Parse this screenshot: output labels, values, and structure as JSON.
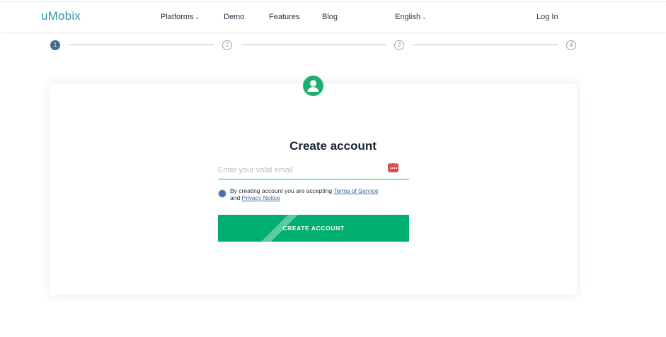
{
  "header": {
    "logo": "uMobix",
    "nav": {
      "platforms": "Platforms",
      "demo": "Demo",
      "features": "Features",
      "blog": "Blog",
      "language": "English",
      "login": "Log In"
    }
  },
  "stepper": {
    "steps": [
      "1",
      "2",
      "3",
      "4"
    ],
    "current": 1
  },
  "form": {
    "title": "Create account",
    "email_placeholder": "Enter your valid email",
    "email_value": "",
    "terms_prefix": "By creating account you are accepting ",
    "terms_link": "Terms of Service",
    "terms_and": " and ",
    "privacy_link": "Privacy Notice",
    "submit_label": "CREATE ACCOUNT"
  },
  "colors": {
    "brand_teal": "#2a9aa8",
    "accent_green": "#00ae70",
    "step_active": "#3f6b94",
    "link": "#3d6a9a",
    "password_manager_icon": "#e04a4a"
  },
  "icons": {
    "avatar": "user-circle-icon",
    "chevron": "chevron-down-icon",
    "password_manager": "password-manager-icon"
  }
}
